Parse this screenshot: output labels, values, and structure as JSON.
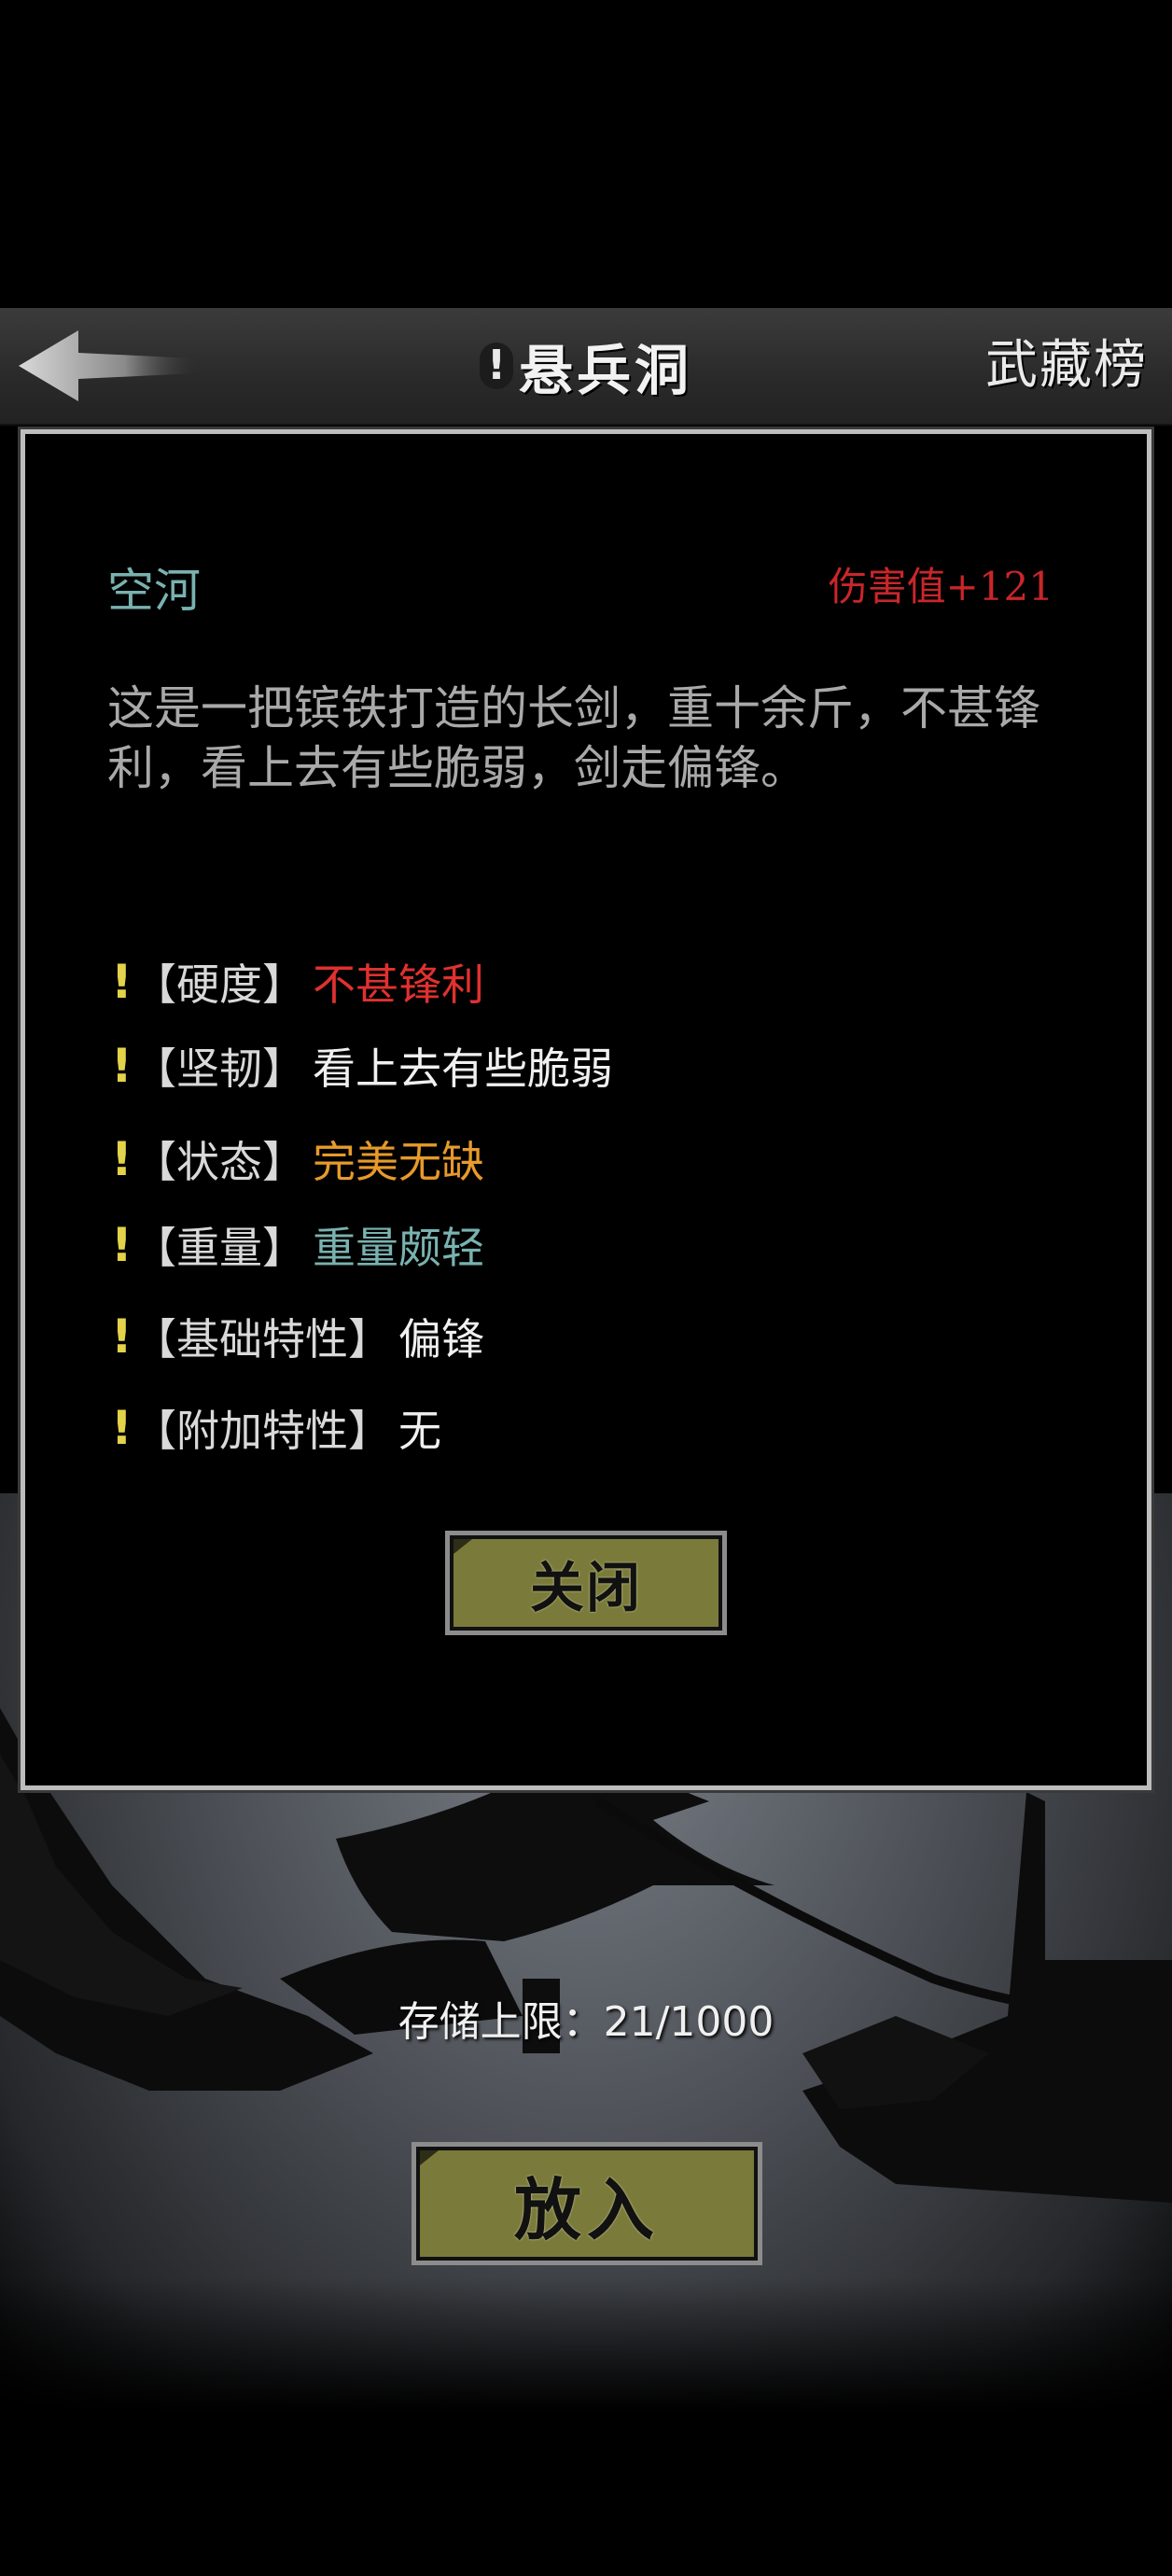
{
  "header": {
    "title_alert": "!",
    "title": "悬兵洞",
    "ranking_link": "武藏榜"
  },
  "item": {
    "name": "空河",
    "damage": "伤害值+121",
    "description": "这是一把镔铁打造的长剑，重十余斤，不甚锋利，看上去有些脆弱，剑走偏锋。",
    "attributes": [
      {
        "mark": "!",
        "label": "【硬度】",
        "value": "不甚锋利",
        "color": "#e0312f"
      },
      {
        "mark": "!",
        "label": "【坚韧】",
        "value": "看上去有些脆弱",
        "color": "#f0f0f0"
      },
      {
        "mark": "!",
        "label": "【状态】",
        "value": "完美无缺",
        "color": "#e79a2a"
      },
      {
        "mark": "!",
        "label": "【重量】",
        "value": "重量颇轻",
        "color": "#79b2b0"
      },
      {
        "mark": "!",
        "label": "【基础特性】",
        "value": "偏锋",
        "color": "#f0f0f0"
      },
      {
        "mark": "!",
        "label": "【附加特性】",
        "value": "无",
        "color": "#f0f0f0"
      }
    ]
  },
  "buttons": {
    "close_label": "关闭",
    "put_in_label": "放入"
  },
  "storage": {
    "label": "存储上限：21/1000"
  },
  "colors": {
    "button_olive": "#7a7a3a",
    "name_teal": "#79b2b0",
    "damage_red": "#c9262a",
    "mark_yellow": "#e3d34a"
  }
}
